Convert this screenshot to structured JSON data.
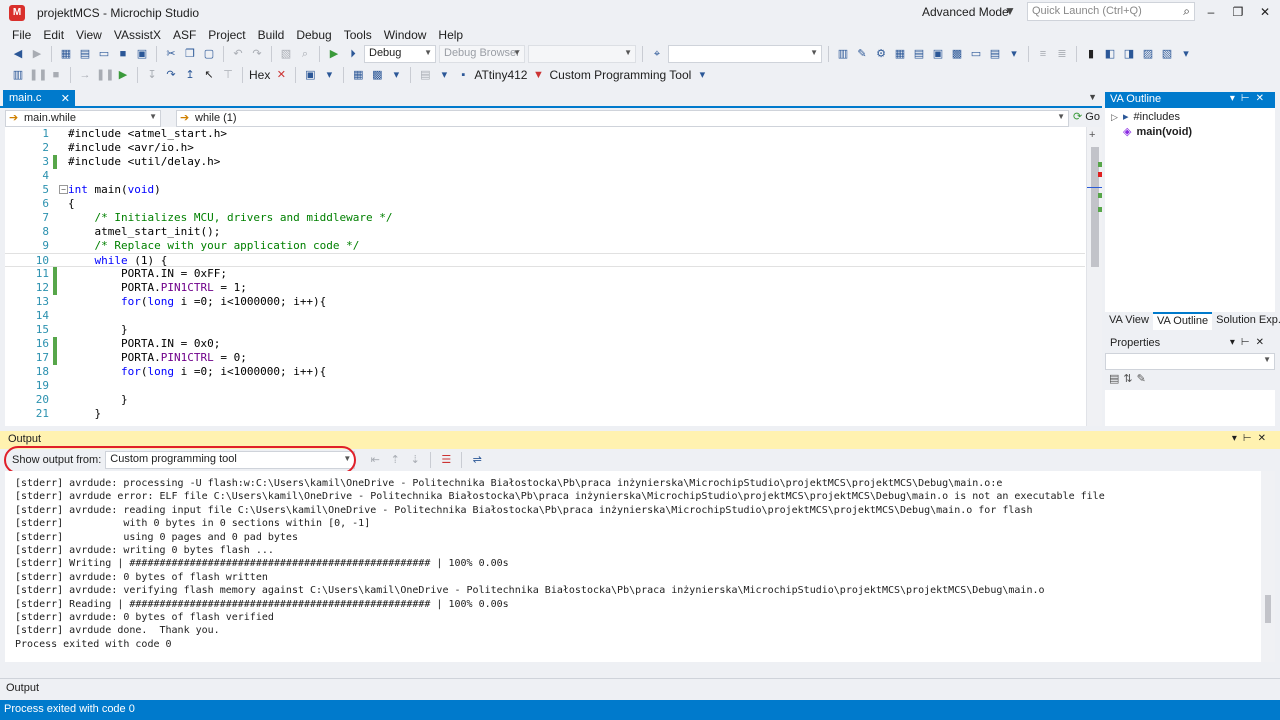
{
  "window": {
    "title": "projektMCS - Microchip Studio",
    "mode": "Advanced Mode",
    "quick_launch_placeholder": "Quick Launch (Ctrl+Q)"
  },
  "menu": [
    "File",
    "Edit",
    "View",
    "VAssistX",
    "ASF",
    "Project",
    "Build",
    "Debug",
    "Tools",
    "Window",
    "Help"
  ],
  "toolbar": {
    "config": "Debug",
    "debug_browser": "Debug Browser",
    "hex_label": "Hex",
    "device": "ATtiny412",
    "tool": "Custom Programming Tool"
  },
  "editor": {
    "tab": "main.c",
    "nav_scope": "main.while",
    "nav_member": "while (1)",
    "go_label": "Go",
    "lines": [
      {
        "n": "1",
        "text": "#include <atmel_start.h>",
        "chg": false
      },
      {
        "n": "2",
        "text": "#include <avr/io.h>",
        "chg": false
      },
      {
        "n": "3",
        "text": "#include <util/delay.h>",
        "chg": true
      },
      {
        "n": "4",
        "text": "",
        "chg": false
      },
      {
        "n": "5",
        "text": "int main(void)",
        "chg": false
      },
      {
        "n": "6",
        "text": "{",
        "chg": false
      },
      {
        "n": "7",
        "text": "    /* Initializes MCU, drivers and middleware */",
        "chg": false
      },
      {
        "n": "8",
        "text": "    atmel_start_init();",
        "chg": false
      },
      {
        "n": "9",
        "text": "    /* Replace with your application code */",
        "chg": false
      },
      {
        "n": "10",
        "text": "    while (1) {",
        "chg": false
      },
      {
        "n": "11",
        "text": "        PORTA.IN = 0xFF;",
        "chg": true
      },
      {
        "n": "12",
        "text": "        PORTA.PIN1CTRL = 1;",
        "chg": true
      },
      {
        "n": "13",
        "text": "        for(long i =0; i<1000000; i++){",
        "chg": false
      },
      {
        "n": "14",
        "text": "",
        "chg": false
      },
      {
        "n": "15",
        "text": "        }",
        "chg": false
      },
      {
        "n": "16",
        "text": "        PORTA.IN = 0x0;",
        "chg": true
      },
      {
        "n": "17",
        "text": "        PORTA.PIN1CTRL = 0;",
        "chg": true
      },
      {
        "n": "18",
        "text": "        for(long i =0; i<1000000; i++){",
        "chg": false
      },
      {
        "n": "19",
        "text": "",
        "chg": false
      },
      {
        "n": "20",
        "text": "        }",
        "chg": false
      },
      {
        "n": "21",
        "text": "    }",
        "chg": false
      }
    ]
  },
  "va_outline": {
    "title": "VA Outline",
    "items": [
      "#includes",
      "main(void)"
    ]
  },
  "side_tabs": [
    "VA View",
    "VA Outline",
    "Solution Exp..."
  ],
  "properties": {
    "title": "Properties"
  },
  "output": {
    "title": "Output",
    "show_from_label": "Show output from:",
    "source": "Custom programming tool",
    "lines": [
      "[stderr] avrdude: processing -U flash:w:C:\\Users\\kamil\\OneDrive - Politechnika Białostocka\\Pb\\praca inżynierska\\MicrochipStudio\\projektMCS\\projektMCS\\Debug\\main.o:e",
      "[stderr] avrdude error: ELF file C:\\Users\\kamil\\OneDrive - Politechnika Białostocka\\Pb\\praca inżynierska\\MicrochipStudio\\projektMCS\\projektMCS\\Debug\\main.o is not an executable file",
      "[stderr] avrdude: reading input file C:\\Users\\kamil\\OneDrive - Politechnika Białostocka\\Pb\\praca inżynierska\\MicrochipStudio\\projektMCS\\projektMCS\\Debug\\main.o for flash",
      "[stderr]          with 0 bytes in 0 sections within [0, -1]",
      "[stderr]          using 0 pages and 0 pad bytes",
      "[stderr] avrdude: writing 0 bytes flash ...",
      "[stderr] Writing | ################################################## | 100% 0.00s",
      "[stderr] avrdude: 0 bytes of flash written",
      "[stderr] avrdude: verifying flash memory against C:\\Users\\kamil\\OneDrive - Politechnika Białostocka\\Pb\\praca inżynierska\\MicrochipStudio\\projektMCS\\projektMCS\\Debug\\main.o",
      "[stderr] Reading | ################################################## | 100% 0.00s",
      "[stderr] avrdude: 0 bytes of flash verified",
      "[stderr] avrdude done.  Thank you.",
      "Process exited with code 0"
    ]
  },
  "bottom_tab": "Output",
  "status": "Process exited with code 0",
  "colors": {
    "accent": "#007acc",
    "output_header": "#fff2b0",
    "highlight_ring": "#e0202a"
  }
}
